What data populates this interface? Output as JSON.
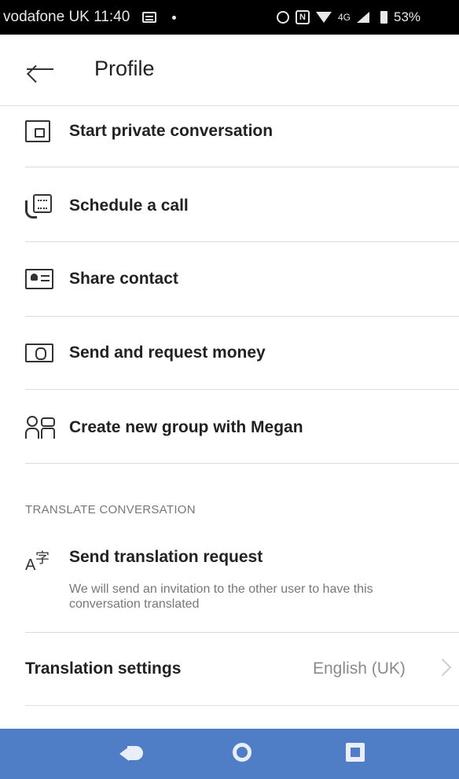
{
  "status_bar": {
    "carrier_time": "vodafone UK 11:40",
    "network": "4G",
    "battery": "53%"
  },
  "header": {
    "back_icon": "arrow-left-icon",
    "title": "Profile"
  },
  "menu": [
    {
      "label": "Start private conversation",
      "icon": "private-conversation-icon"
    },
    {
      "label": "Schedule a call",
      "icon": "schedule-call-icon"
    },
    {
      "label": "Share contact",
      "icon": "contact-card-icon"
    },
    {
      "label": "Send and request money",
      "icon": "money-icon"
    },
    {
      "label": "Create new group with Megan",
      "icon": "group-icon"
    }
  ],
  "translate": {
    "section_header": "TRANSLATE CONVERSATION",
    "request_title": "Send translation request",
    "request_desc": "We will send an invitation to the other user to have this conversation translated",
    "settings_label": "Translation settings",
    "settings_value": "English (UK)"
  },
  "nav": {
    "back": "nav-back-icon",
    "home": "nav-home-icon",
    "recent": "nav-recent-icon"
  }
}
